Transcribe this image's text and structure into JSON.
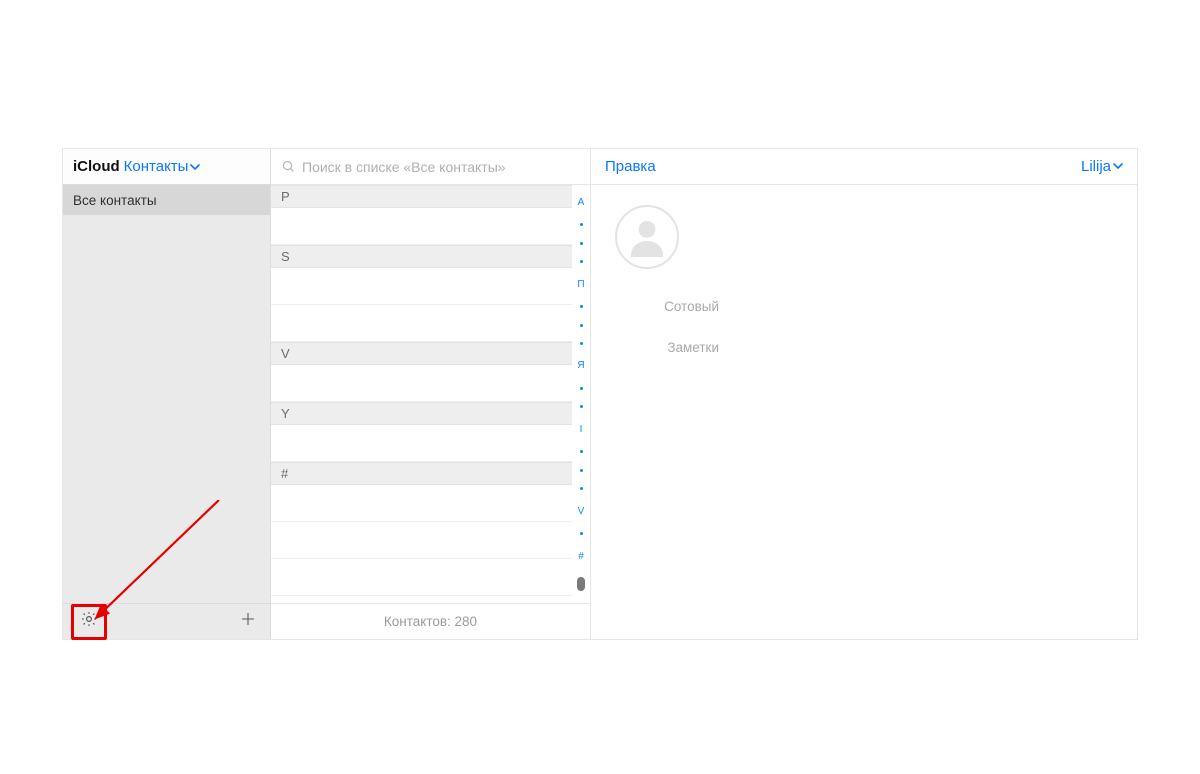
{
  "sidebar": {
    "brand_label": "iCloud",
    "section_label": "Контакты",
    "groups": [
      {
        "label": "Все контакты",
        "selected": true
      }
    ]
  },
  "search": {
    "placeholder": "Поиск в списке «Все контакты»"
  },
  "list": {
    "sections": [
      {
        "letter": "P",
        "rows": [
          ""
        ]
      },
      {
        "letter": "S",
        "rows": [
          "",
          ""
        ]
      },
      {
        "letter": "V",
        "rows": [
          ""
        ]
      },
      {
        "letter": "Y",
        "rows": [
          ""
        ]
      },
      {
        "letter": "#",
        "rows": [
          "",
          "",
          ""
        ]
      }
    ],
    "alpha_index": [
      "А",
      "•",
      "•",
      "•",
      "П",
      "•",
      "•",
      "•",
      "Я",
      "•",
      "•",
      "I",
      "•",
      "•",
      "•",
      "V",
      "•",
      "#"
    ],
    "footer_label": "Контактов: 280"
  },
  "detail": {
    "edit_label": "Правка",
    "user_menu_label": "Lilija",
    "fields": {
      "mobile_label": "Сотовый",
      "mobile_value": "",
      "notes_label": "Заметки",
      "notes_value": ""
    }
  },
  "colors": {
    "accent": "#0a77ff",
    "annotation": "#e60000"
  }
}
